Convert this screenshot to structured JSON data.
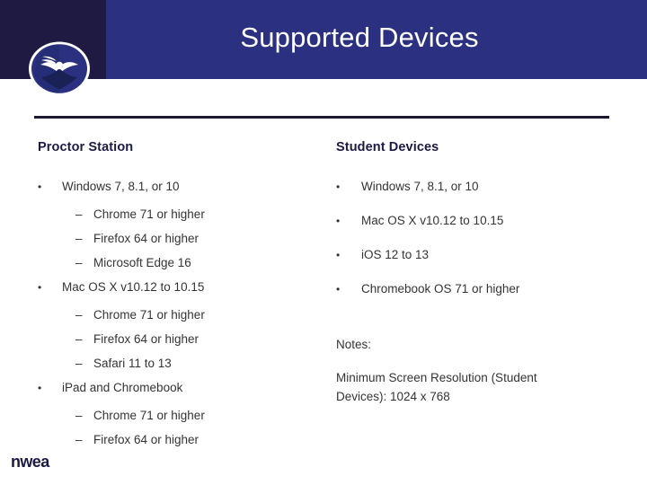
{
  "header": {
    "title": "Supported Devices",
    "band_color": "#2b3180",
    "block_color": "#1e1a42",
    "title_color": "#ffffff"
  },
  "logo": {
    "name": "nwea-emblem-logo",
    "wordmark": "nwea",
    "wordmark_color": "#1b1b45"
  },
  "columns": {
    "left": {
      "heading": "Proctor Station",
      "items": [
        {
          "level": 1,
          "marker": "•",
          "text": "Windows 7, 8.1, or 10"
        },
        {
          "level": 2,
          "marker": "–",
          "text": "Chrome 71 or higher"
        },
        {
          "level": 2,
          "marker": "–",
          "text": "Firefox 64 or higher"
        },
        {
          "level": 2,
          "marker": "–",
          "text": "Microsoft Edge 16"
        },
        {
          "level": 1,
          "marker": "•",
          "text": "Mac OS X v10.12 to 10.15"
        },
        {
          "level": 2,
          "marker": "–",
          "text": "Chrome 71 or higher"
        },
        {
          "level": 2,
          "marker": "–",
          "text": "Firefox 64 or higher"
        },
        {
          "level": 2,
          "marker": "–",
          "text": "Safari 11 to 13"
        },
        {
          "level": 1,
          "marker": "•",
          "text": "iPad and Chromebook"
        },
        {
          "level": 2,
          "marker": "–",
          "text": "Chrome 71 or higher"
        },
        {
          "level": 2,
          "marker": "–",
          "text": "Firefox 64 or higher"
        }
      ]
    },
    "right": {
      "heading": "Student Devices",
      "items": [
        {
          "level": 1,
          "marker": "•",
          "text": "Windows 7, 8.1, or 10"
        },
        {
          "level": 1,
          "marker": "•",
          "text": "Mac OS X v10.12 to 10.15"
        },
        {
          "level": 1,
          "marker": "•",
          "text": "iOS 12 to 13"
        },
        {
          "level": 1,
          "marker": "•",
          "text": "Chromebook OS 71 or higher"
        }
      ],
      "notes": {
        "label": "Notes:",
        "text": "Minimum Screen Resolution (Student Devices): 1024 x 768"
      }
    }
  },
  "styles": {
    "heading_color": "#1b1b45",
    "body_color": "#343434",
    "rule_color": "#1b1833"
  }
}
